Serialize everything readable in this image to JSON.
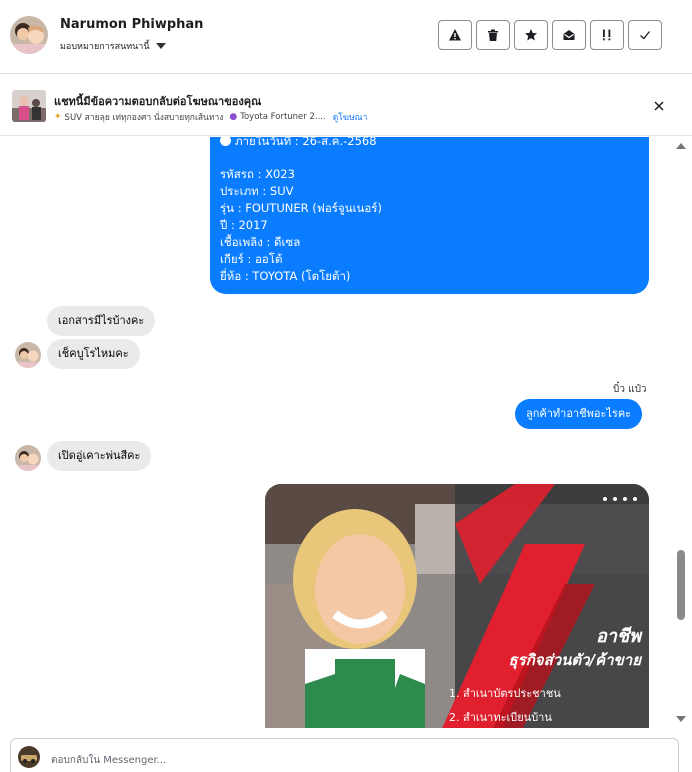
{
  "header": {
    "contact_name": "Narumon Phiwphan",
    "assign_label": "มอบหมายการสนทนานี้",
    "actions": [
      "warning-icon",
      "trash-icon",
      "star-icon",
      "mark-unread-icon",
      "priority-icon",
      "done-icon"
    ]
  },
  "ad_reply": {
    "title": "แชทนี้มีข้อความตอบกลับต่อโฆษณาของคุณ",
    "subtitle": "SUV สายลุย เท่ทุกองศา นั่งสบายทุกเส้นทาง",
    "subtitle_2": "Toyota Fortuner 2....",
    "link": "ดูโฆษณา"
  },
  "messages": {
    "card_lines": [
      "ภายในวันที่ : 26-ส.ค.-2568",
      "",
      "รหัสรถ : X023",
      "ประเภท : SUV",
      "รุ่น : FOUTUNER (ฟอร์จูนเนอร์)",
      "ปี : 2017",
      "เชื้อเพลิง : ดีเซล",
      "เกียร์ : ออโต้",
      "ยี่ห้อ : TOYOTA (โตโยต้า)"
    ],
    "in_1": "เอกสารมีไรบ้างคะ",
    "in_2": "เช็คบูโรไหมคะ",
    "sender_name": "บิ๋ว แป๋ว",
    "out_1": "ลูกค้าทำอาชีพอะไรคะ",
    "in_3": "เปิดอู่เคาะพ่นสีคะ",
    "image_text": {
      "heading": "อาชีพ",
      "subheading": "ธุรกิจส่วนตัว/ค้าขาย",
      "item_1": "1. สำเนาบัตรประชาชน",
      "item_2": "2. สำเนาทะเบียนบ้าน"
    }
  },
  "composer": {
    "placeholder": "ตอบกลับใน Messenger..."
  },
  "colors": {
    "brand_blue": "#0a7cff",
    "incoming_bubble": "#e9eaeb",
    "poster_red": "#e0202e"
  }
}
